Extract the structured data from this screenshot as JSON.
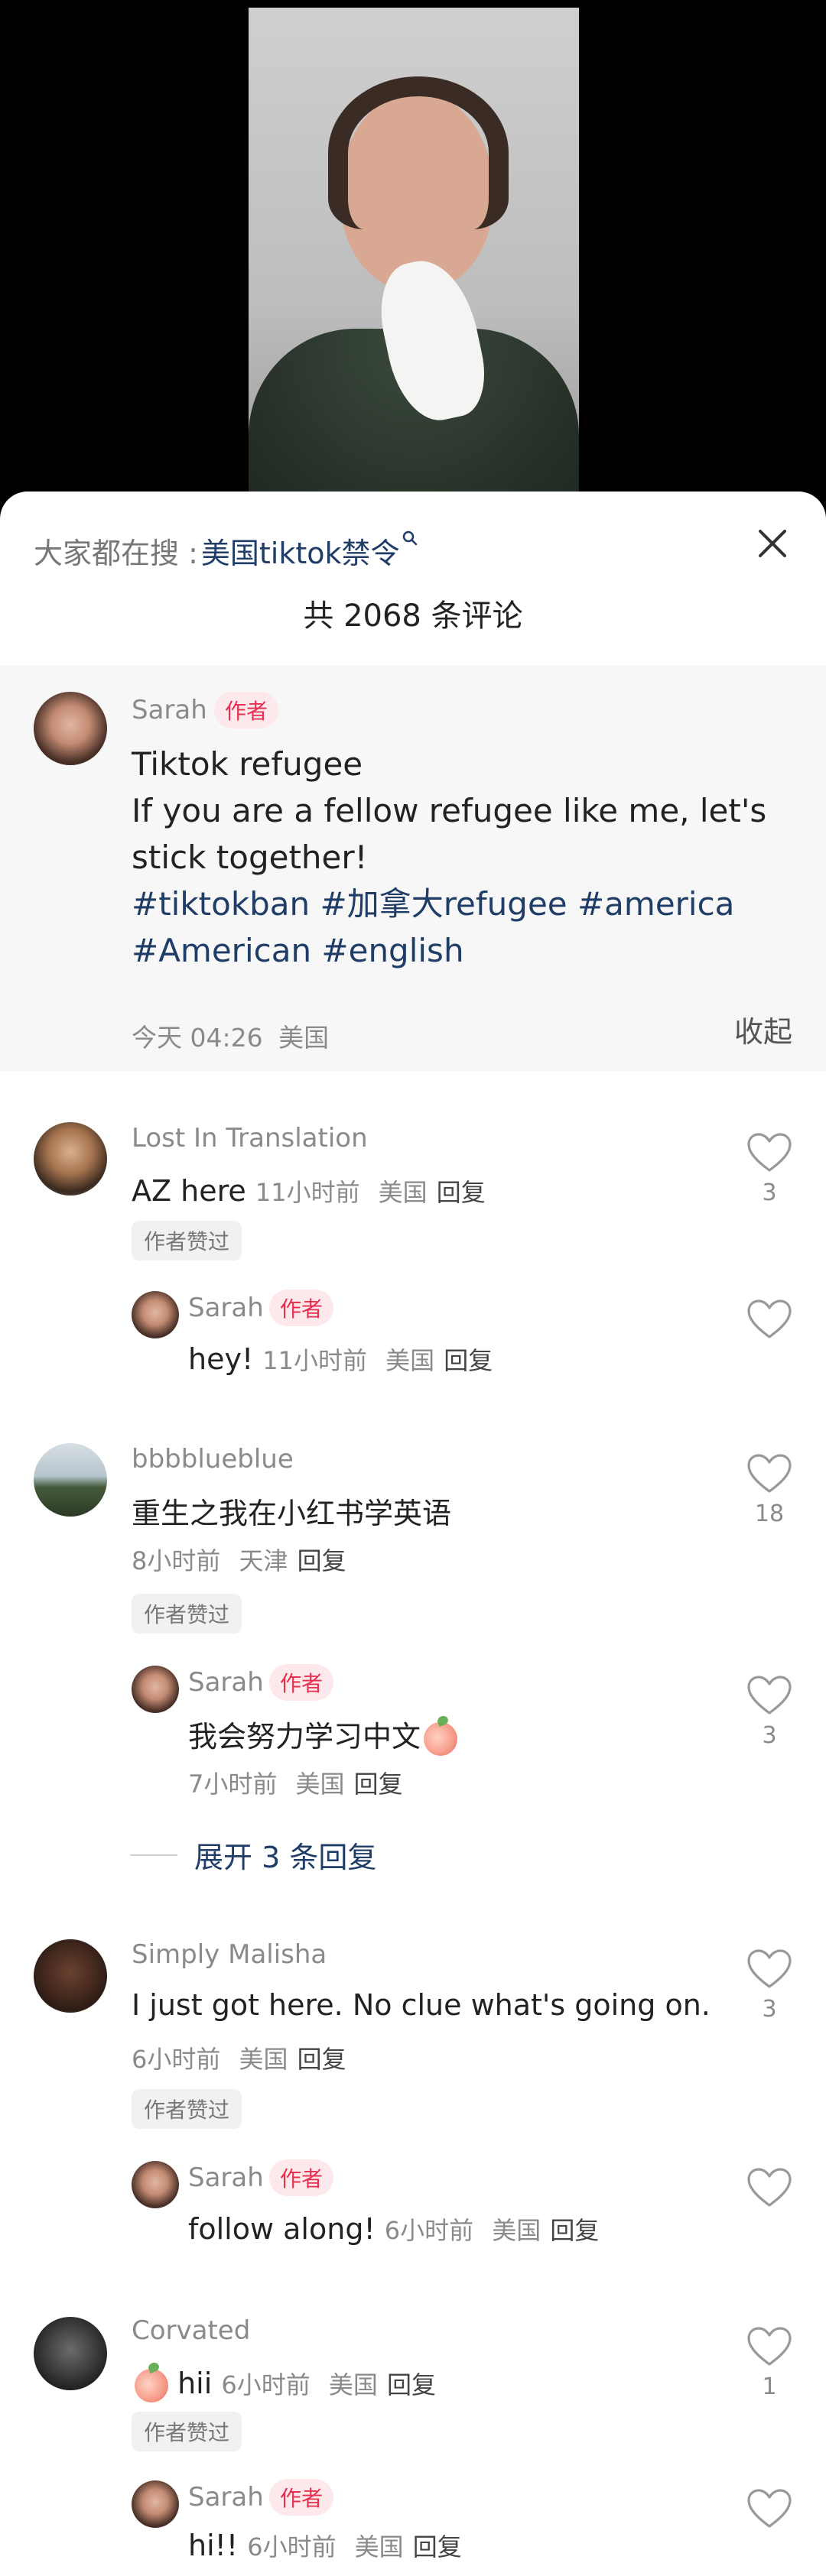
{
  "header": {
    "search_prefix": "大家都在搜 :",
    "search_term": "美国tiktok禁令",
    "comment_count_title": "共 2068 条评论"
  },
  "post": {
    "author": "Sarah",
    "author_badge": "作者",
    "line1": "Tiktok refugee",
    "line2": "If you are a fellow refugee like me, let's stick together!",
    "tags": "#tiktokban #加拿大refugee #america #American #english",
    "time": "今天 04:26",
    "location": "美国",
    "collapse_label": "收起"
  },
  "labels": {
    "reply": "回复",
    "author_liked": "作者赞过",
    "author_badge": "作者"
  },
  "comments": [
    {
      "user": "Lost In Translation",
      "text": "AZ here",
      "time": "11小时前",
      "location": "美国",
      "likes": "3",
      "reply": {
        "user": "Sarah",
        "text": "hey!",
        "time": "11小时前",
        "location": "美国"
      }
    },
    {
      "user": "bbbblueblue",
      "text": "重生之我在小红书学英语",
      "time": "8小时前",
      "location": "天津",
      "likes": "18",
      "reply": {
        "user": "Sarah",
        "text": "我会努力学习中文",
        "time": "7小时前",
        "location": "美国",
        "likes": "3"
      },
      "expand_label": "展开 3 条回复"
    },
    {
      "user": "Simply Malisha",
      "text": "I just got here. No clue what's going on.",
      "time": "6小时前",
      "location": "美国",
      "likes": "3",
      "reply": {
        "user": "Sarah",
        "text": "follow along!",
        "time": "6小时前",
        "location": "美国"
      }
    },
    {
      "user": "Corvated",
      "text": "hii",
      "time": "6小时前",
      "location": "美国",
      "likes": "1",
      "reply": {
        "user": "Sarah",
        "text": "hi!!",
        "time": "6小时前",
        "location": "美国"
      }
    }
  ],
  "icons": {
    "close": "close-icon",
    "heart": "heart-outline-icon",
    "search_hint": "search-icon"
  },
  "colors": {
    "link_blue": "#1f3d67",
    "author_red": "#e7304f",
    "meta_gray": "#8a8a8a"
  }
}
